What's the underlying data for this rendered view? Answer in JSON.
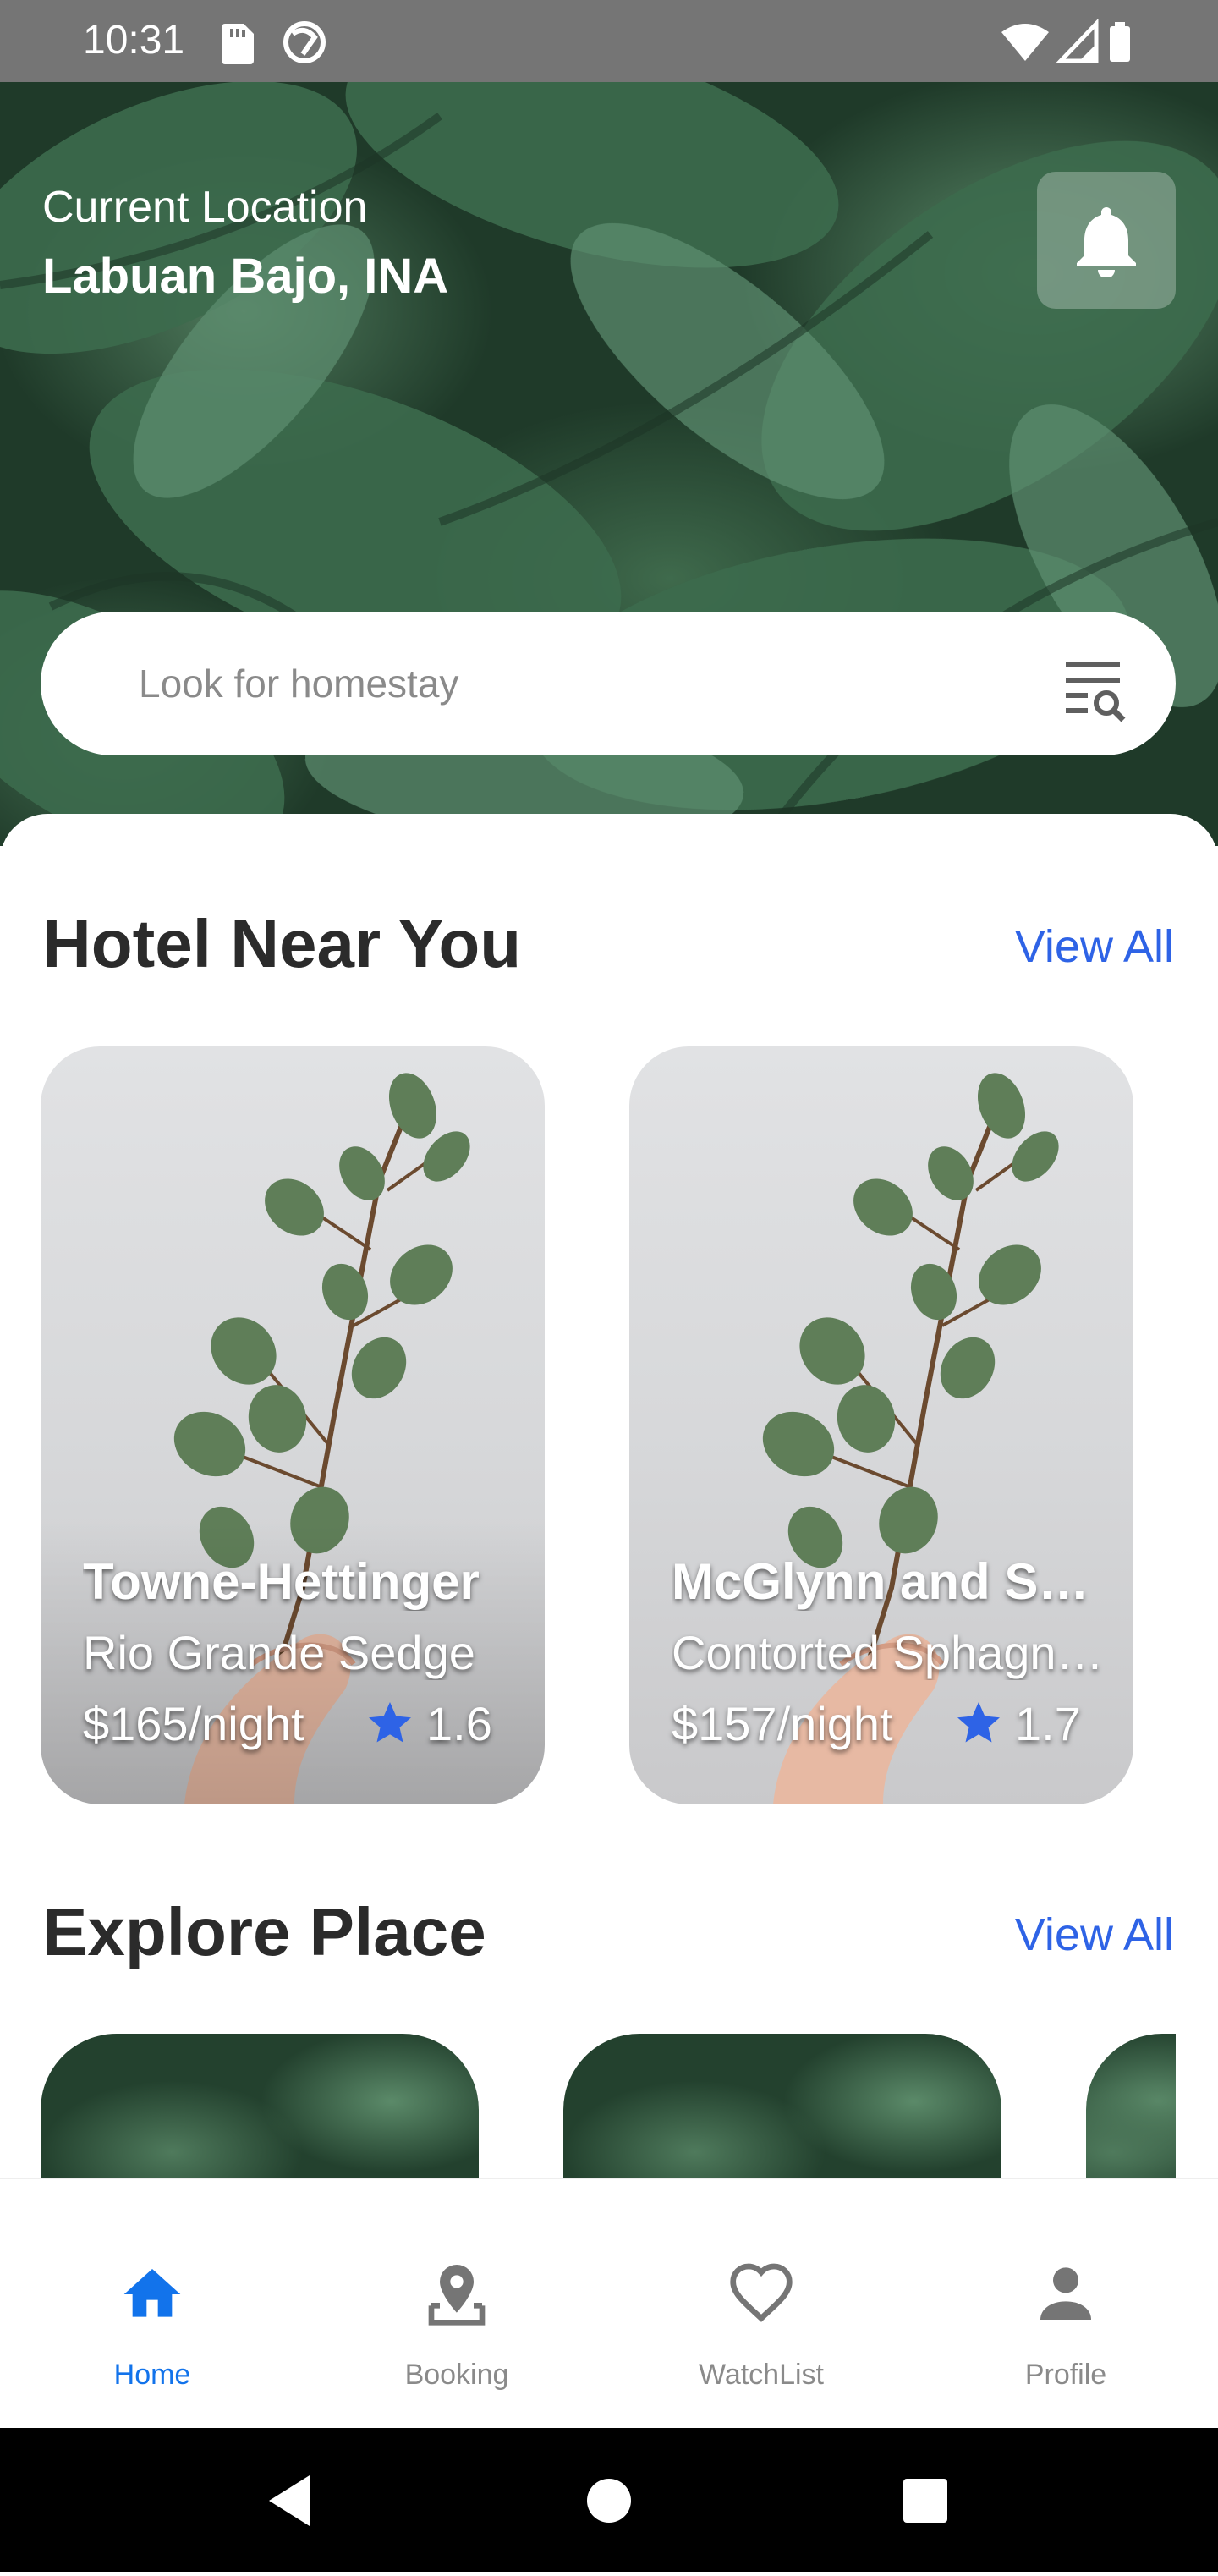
{
  "status_bar": {
    "time": "10:31",
    "left_icons": [
      "sd-card-icon",
      "do-not-disturb-icon"
    ],
    "right_icons": [
      "wifi-icon",
      "cellular-signal-icon",
      "battery-icon"
    ]
  },
  "header": {
    "location_label": "Current Location",
    "location_value": "Labuan Bajo, INA",
    "notification_icon": "bell-icon"
  },
  "search": {
    "placeholder": "Look for homestay",
    "value": "",
    "filter_icon": "filter-search-icon"
  },
  "hotels_section": {
    "title": "Hotel Near You",
    "view_all": "View All",
    "cards": [
      {
        "name": "Towne-Hettinger",
        "location": "Rio Grande Sedge",
        "price": "$165/night",
        "rating": "1.6"
      },
      {
        "name": "McGlynn and Sons",
        "location": "Contorted Sphagnum",
        "price": "$157/night",
        "rating": "1.7"
      }
    ]
  },
  "explore_section": {
    "title": "Explore Place",
    "view_all": "View All"
  },
  "bottom_nav": {
    "items": [
      {
        "label": "Home",
        "icon": "home-icon",
        "active": true
      },
      {
        "label": "Booking",
        "icon": "map-pin-icon",
        "active": false
      },
      {
        "label": "WatchList",
        "icon": "heart-icon",
        "active": false
      },
      {
        "label": "Profile",
        "icon": "person-icon",
        "active": false
      }
    ]
  },
  "system_nav": {
    "buttons": [
      "back-icon",
      "home-circle-icon",
      "recents-icon"
    ]
  },
  "colors": {
    "accent": "#2e63e6",
    "nav_active": "#1273eb",
    "nav_inactive": "#8a8a8a",
    "status_bar": "#757575"
  }
}
